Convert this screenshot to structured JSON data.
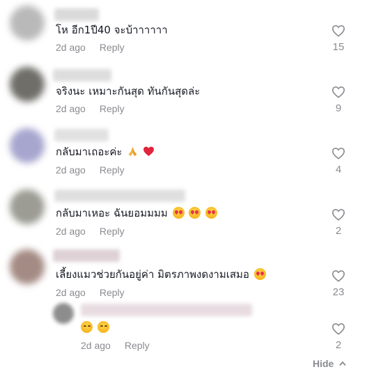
{
  "comments": [
    {
      "text": "โห อีก1ปี40 จะบ้าาาาาา",
      "time": "2d ago",
      "reply": "Reply",
      "likes": "15",
      "avatar_color": "#b9b9b9",
      "name_color": "#d4d4d4"
    },
    {
      "text": "จริงนะ เหมาะกันสุด ทันกันสุดล่ะ",
      "time": "2d ago",
      "reply": "Reply",
      "likes": "9",
      "avatar_color": "#6f6e69",
      "name_color": "#d8d8d8"
    },
    {
      "text": "กลับมาเถอะค่ะ",
      "time": "2d ago",
      "reply": "Reply",
      "likes": "4",
      "avatar_color": "#a7a6cf",
      "name_color": "#dcdcdc"
    },
    {
      "text": "กลับมาเหอะ ฉันยอมมมม",
      "time": "2d ago",
      "reply": "Reply",
      "likes": "2",
      "avatar_color": "#9c9c94",
      "name_color": "#dadada"
    },
    {
      "text": "เลี้ยงแมวช่วยกันอยู่ค่า มิตรภาพงดงามเสมอ",
      "time": "2d ago",
      "reply": "Reply",
      "likes": "23",
      "avatar_color": "#a48b83",
      "name_color": "#d9c9cf"
    },
    {
      "text": "",
      "time": "2d ago",
      "reply": "Reply",
      "likes": "2",
      "avatar_color": "#8d8d8d",
      "name_color": "#e4d6dc"
    }
  ],
  "emojis": {
    "c3": [
      "folded-hands",
      "red-heart"
    ],
    "c4": [
      "smiling-face-with-heart-eyes",
      "smiling-face-with-heart-eyes",
      "smiling-face-with-heart-eyes"
    ],
    "c5": [
      "smiling-face-with-heart-eyes"
    ],
    "c6": [
      "smiling-face",
      "smiling-face"
    ]
  },
  "hide_label": "Hide",
  "icon_color": "#8a8b91"
}
